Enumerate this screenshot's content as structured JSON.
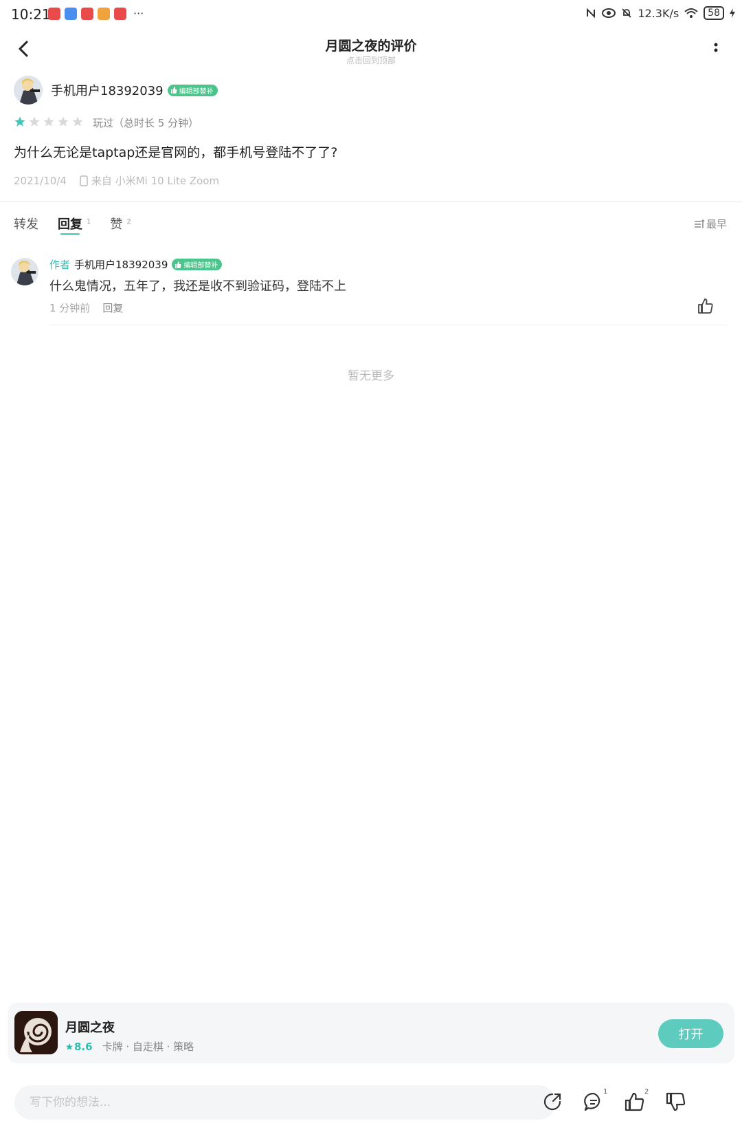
{
  "status_bar": {
    "time": "10:21",
    "dots": "···",
    "speed": "12.3K/s",
    "battery": "58"
  },
  "header": {
    "title": "月圆之夜的评价",
    "subtitle": "点击回到顶部"
  },
  "review": {
    "username": "手机用户18392039",
    "badge": "编辑部替补",
    "rating": 1,
    "max_rating": 5,
    "played": "玩过（总时长 5 分钟）",
    "content": "为什么无论是taptap还是官网的，都手机号登陆不了了?",
    "date": "2021/10/4",
    "device": "来自 小米Mi 10 Lite Zoom"
  },
  "tabs": [
    {
      "label": "转发",
      "count": ""
    },
    {
      "label": "回复",
      "count": "1"
    },
    {
      "label": "赞",
      "count": "2"
    }
  ],
  "sort_label": "最早",
  "comment": {
    "author_tag": "作者",
    "username": "手机用户18392039",
    "badge": "编辑部替补",
    "text": "什么鬼情况，五年了，我还是收不到验证码，登陆不上",
    "time": "1 分钟前",
    "reply_label": "回复"
  },
  "no_more": "暂无更多",
  "app": {
    "name": "月圆之夜",
    "score": "8.6",
    "tags": "卡牌 · 自走棋 · 策略",
    "open_label": "打开"
  },
  "bottom_bar": {
    "placeholder": "写下你的想法...",
    "comment_count": "1",
    "like_count": "2"
  },
  "colors": {
    "accent": "#5dccbf",
    "badge": "#4cc48b",
    "star_active": "#3fc8b8",
    "star_inactive": "#d9d9d9"
  }
}
